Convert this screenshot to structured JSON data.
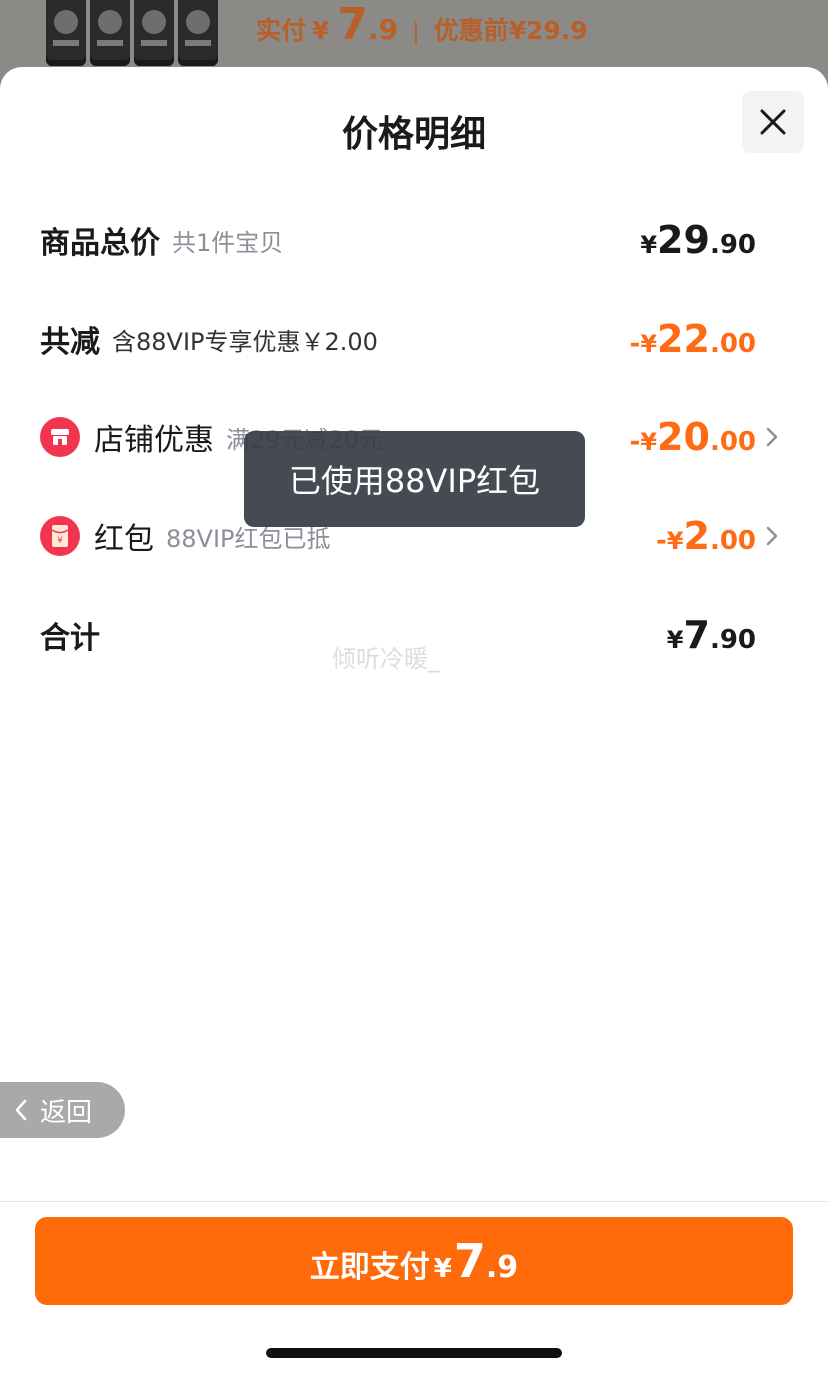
{
  "background": {
    "price_label": "实付",
    "price_yen": "¥",
    "price_int": "7",
    "price_dec": ".9",
    "separator": "|",
    "original_price": "优惠前¥29.9"
  },
  "sheet": {
    "title": "价格明细"
  },
  "rows": {
    "total": {
      "label": "商品总价",
      "sub": "共1件宝贝",
      "yen": "¥",
      "int": "29",
      "dec": ".90"
    },
    "reduction": {
      "label": "共减",
      "sub": "含88VIP专享优惠￥2.00",
      "sign": "-",
      "yen": "¥",
      "int": "22",
      "dec": ".00"
    },
    "store_discount": {
      "label": "店铺优惠",
      "sub": "满29元减20元",
      "sign": "-",
      "yen": "¥",
      "int": "20",
      "dec": ".00"
    },
    "red_packet": {
      "label": "红包",
      "sub": "88VIP红包已抵",
      "sign": "-",
      "yen": "¥",
      "int": "2",
      "dec": ".00"
    },
    "sum": {
      "label": "合计",
      "yen": "¥",
      "int": "7",
      "dec": ".90"
    }
  },
  "toast": {
    "text": "已使用88VIP红包"
  },
  "watermark": {
    "text": "倾听冷暖_"
  },
  "back": {
    "label": "返回"
  },
  "pay": {
    "label": "立即支付",
    "yen": "¥",
    "int": "7",
    "dec": ".9"
  },
  "colors": {
    "accent_orange": "#ff6a0a",
    "discount_orange": "#ff6a14",
    "icon_red": "#f2354f"
  },
  "icons": {
    "close": "close-icon",
    "store": "store-icon",
    "red_packet": "red-packet-icon",
    "chevron": "chevron-right-icon",
    "back": "chevron-left-icon"
  }
}
